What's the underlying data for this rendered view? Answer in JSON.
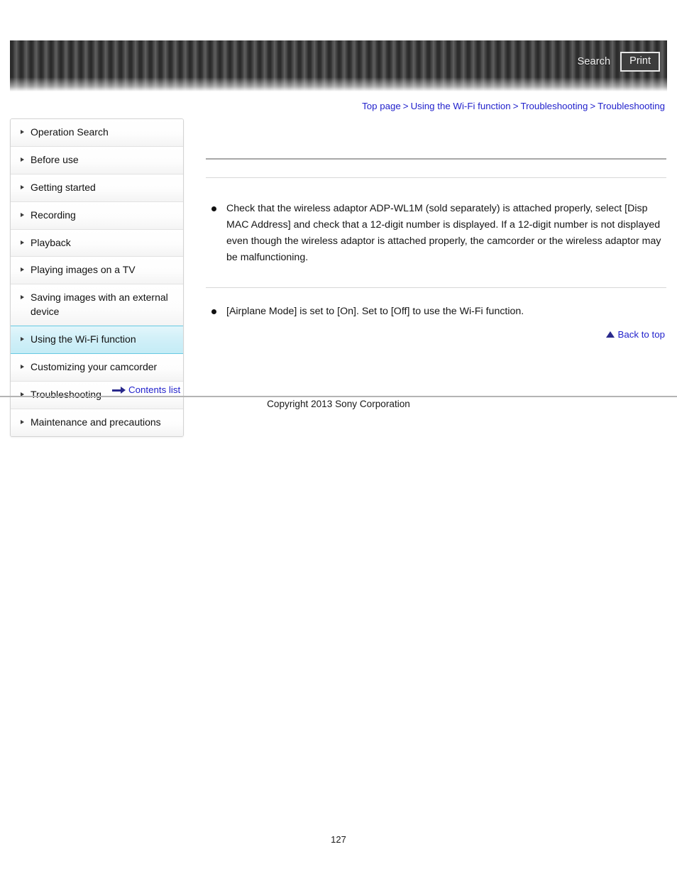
{
  "header": {
    "search_label": "Search",
    "print_label": "Print",
    "search_icon": "search-icon",
    "print_icon": "print-icon"
  },
  "breadcrumb": {
    "separator": ">",
    "items": [
      {
        "label": "Top page"
      },
      {
        "label": "Using the Wi-Fi function"
      },
      {
        "label": "Troubleshooting"
      },
      {
        "label": "Troubleshooting"
      }
    ]
  },
  "sidebar": {
    "items": [
      {
        "label": "Operation Search",
        "active": false
      },
      {
        "label": "Before use",
        "active": false
      },
      {
        "label": "Getting started",
        "active": false
      },
      {
        "label": "Recording",
        "active": false
      },
      {
        "label": "Playback",
        "active": false
      },
      {
        "label": "Playing images on a TV",
        "active": false
      },
      {
        "label": "Saving images with an external device",
        "active": false
      },
      {
        "label": "Using the Wi-Fi function",
        "active": true
      },
      {
        "label": "Customizing your camcorder",
        "active": false
      },
      {
        "label": "Troubleshooting",
        "active": false
      },
      {
        "label": "Maintenance and precautions",
        "active": false
      }
    ],
    "contents_list_label": "Contents list"
  },
  "main": {
    "section_title": "",
    "sub_title": "",
    "bullets": [
      {
        "text": "Check that the wireless adaptor ADP-WL1M (sold separately) is attached properly, select [Disp MAC Address] and check that a 12-digit number is displayed. If a 12-digit number is not displayed even though the wireless adaptor is attached properly, the camcorder or the wireless adaptor may be malfunctioning."
      },
      {
        "text": "[Airplane Mode] is set to [On]. Set to [Off] to use the Wi-Fi function."
      }
    ],
    "back_to_top_label": "Back to top"
  },
  "footer": {
    "copyright": "Copyright 2013 Sony Corporation",
    "page_number": "127"
  },
  "colors": {
    "link_blue": "#2222cc",
    "icon_navy": "#2a2a8c",
    "active_nav_border": "#67c9e2",
    "rule_gray": "#a8a8a8"
  }
}
